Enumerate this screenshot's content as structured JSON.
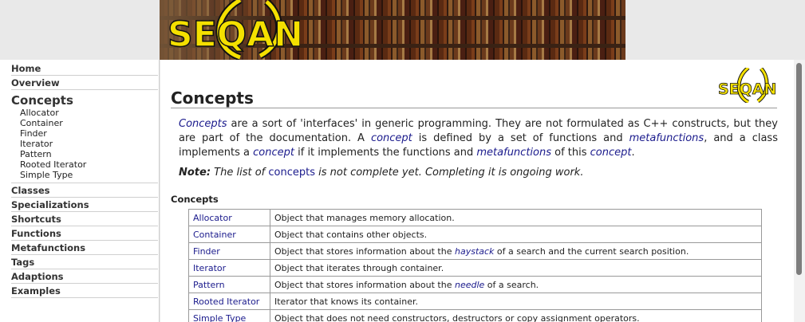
{
  "header": {
    "logo_text": "SEQAN"
  },
  "nav": {
    "items_top": [
      {
        "label": "Home"
      },
      {
        "label": "Overview"
      }
    ],
    "current": {
      "label": "Concepts",
      "children": [
        {
          "label": "Allocator"
        },
        {
          "label": "Container"
        },
        {
          "label": "Finder"
        },
        {
          "label": "Iterator"
        },
        {
          "label": "Pattern"
        },
        {
          "label": "Rooted Iterator"
        },
        {
          "label": "Simple Type"
        }
      ]
    },
    "items_bottom": [
      {
        "label": "Classes"
      },
      {
        "label": "Specializations"
      },
      {
        "label": "Shortcuts"
      },
      {
        "label": "Functions"
      },
      {
        "label": "Metafunctions"
      },
      {
        "label": "Tags"
      },
      {
        "label": "Adaptions"
      },
      {
        "label": "Examples"
      }
    ]
  },
  "main": {
    "logo_text": "SEQAN",
    "title": "Concepts",
    "intro": {
      "p1": "Concepts",
      "p2": " are a sort of 'interfaces' in generic programming. They are not formulated as C++ constructs, but they are part of the documentation. A ",
      "p3": "concept",
      "p4": " is defined by a set of functions and ",
      "p5": "metafunctions",
      "p6": ", and a class implements a ",
      "p7": "concept",
      "p8": " if it implements the functions and ",
      "p9": "metafunctions",
      "p10": " of this ",
      "p11": "concept",
      "p12": "."
    },
    "note": {
      "label": "Note:",
      "t1": " The list of ",
      "link": "concepts",
      "t2": " is not complete yet. Completing it is ongoing work."
    },
    "section_heading": "Concepts",
    "table": {
      "rows": [
        {
          "name": "Allocator",
          "desc": "Object that manages memory allocation."
        },
        {
          "name": "Container",
          "desc": "Object that contains other objects."
        },
        {
          "name": "Finder",
          "d1": "Object that stores information about the ",
          "dlink": "haystack",
          "d2": " of a search and the current search position."
        },
        {
          "name": "Iterator",
          "desc": "Object that iterates through container."
        },
        {
          "name": "Pattern",
          "d1": "Object that stores information about the ",
          "dlink": "needle",
          "d2": " of a search."
        },
        {
          "name": "Rooted Iterator",
          "desc": "Iterator that knows its container."
        },
        {
          "name": "Simple Type",
          "desc": "Object that does not need constructors, destructors or copy assignment operators."
        }
      ]
    }
  },
  "colors": {
    "link": "#1a1a8c",
    "logo_yellow": "#f4e000"
  }
}
